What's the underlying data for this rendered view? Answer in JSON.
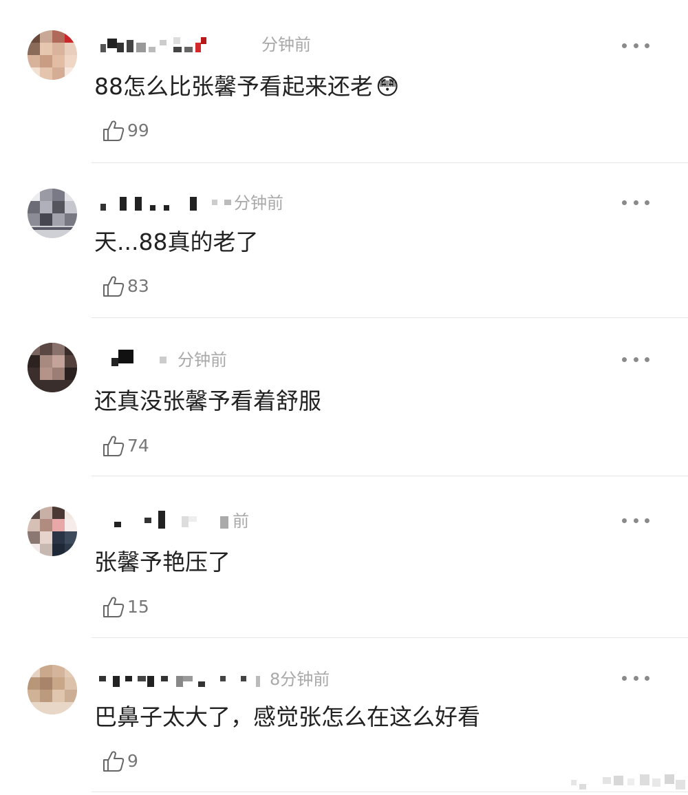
{
  "comments": [
    {
      "time": "分钟前",
      "text": "88怎么比张馨予看起来还老",
      "emoji": "😳",
      "likes": "99"
    },
    {
      "time": "分钟前",
      "text": "天...88真的老了",
      "likes": "83"
    },
    {
      "time": "分钟前",
      "text": "还真没张馨予看着舒服",
      "likes": "74"
    },
    {
      "time": "前",
      "text": "张馨予艳压了",
      "likes": "15"
    },
    {
      "time": "8分钟前",
      "text": "巴鼻子太大了，感觉张怎么在这么好看",
      "likes": "9"
    }
  ],
  "icons": {
    "like": "thumbs-up-icon",
    "more": "more-dots-icon",
    "emoji": "flushed-face-icon"
  },
  "colors": {
    "text": "#222222",
    "meta": "#a8a8a8",
    "like_count": "#777777",
    "divider": "#e6e6e6"
  }
}
